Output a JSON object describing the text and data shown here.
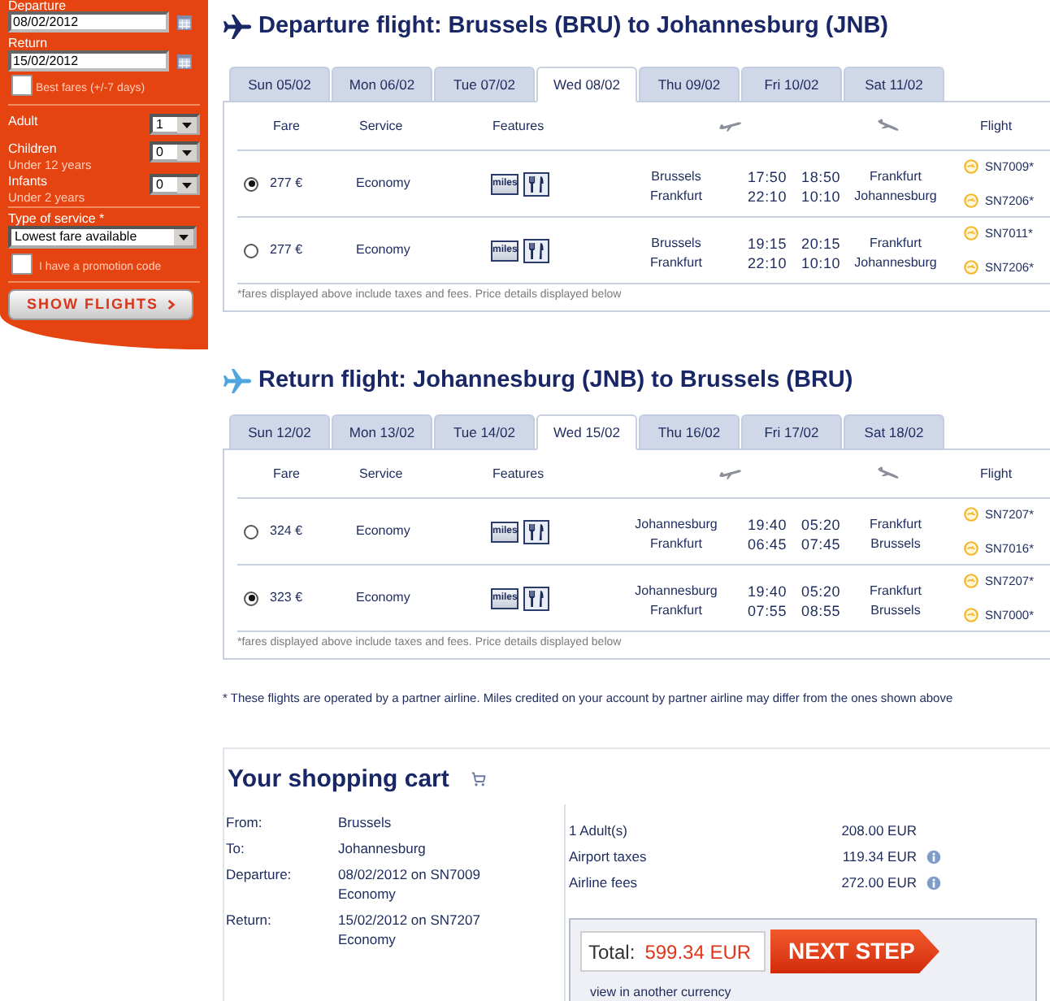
{
  "search_form": {
    "departure": {
      "label": "Departure",
      "value": "08/02/2012"
    },
    "return": {
      "label": "Return",
      "value": "15/02/2012"
    },
    "best_fares": {
      "label": "Best fares (+/-7 days)",
      "checked": false
    },
    "passengers": [
      {
        "label": "Adult",
        "value": "1"
      },
      {
        "label": "Children",
        "note": "Under 12 years",
        "value": "0"
      },
      {
        "label": "Infants",
        "note": "Under 2 years",
        "value": "0"
      }
    ],
    "service_type": {
      "label": "Type of service *",
      "value": "Lowest fare available"
    },
    "promotion_code": {
      "label": "I have a promotion code",
      "checked": false
    },
    "submit_button": "SHOW FLIGHTS"
  },
  "flights": [
    {
      "kind": "departure",
      "title": "Departure flight: Brussels (BRU) to Johannesburg (JNB)",
      "tabs": [
        {
          "label": "Sun 05/02",
          "selected": false
        },
        {
          "label": "Mon 06/02",
          "selected": false
        },
        {
          "label": "Tue 07/02",
          "selected": false
        },
        {
          "label": "Wed 08/02",
          "selected": true
        },
        {
          "label": "Thu 09/02",
          "selected": false
        },
        {
          "label": "Fri 10/02",
          "selected": false
        },
        {
          "label": "Sat 11/02",
          "selected": false
        }
      ],
      "columns": {
        "fare": "Fare",
        "service": "Service",
        "features": "Features",
        "flight": "Flight"
      },
      "rows": [
        {
          "selected": true,
          "fare": "277 €",
          "service": "Economy",
          "features": [
            {
              "kind": "miles",
              "label": "miles"
            },
            {
              "kind": "meal"
            }
          ],
          "segments": [
            {
              "from": "Brussels",
              "depart": "17:50",
              "arrive": "18:50",
              "to": "Frankfurt",
              "flight": "SN7009*"
            },
            {
              "from": "Frankfurt",
              "depart": "22:10",
              "arrive": "10:10",
              "to": "Johannesburg",
              "flight": "SN7206*"
            }
          ]
        },
        {
          "selected": false,
          "fare": "277 €",
          "service": "Economy",
          "features": [
            {
              "kind": "miles",
              "label": "miles"
            },
            {
              "kind": "meal"
            }
          ],
          "segments": [
            {
              "from": "Brussels",
              "depart": "19:15",
              "arrive": "20:15",
              "to": "Frankfurt",
              "flight": "SN7011*"
            },
            {
              "from": "Frankfurt",
              "depart": "22:10",
              "arrive": "10:10",
              "to": "Johannesburg",
              "flight": "SN7206*"
            }
          ]
        }
      ],
      "footnote": "*fares displayed above include taxes and fees. Price details displayed below"
    },
    {
      "kind": "return",
      "title": "Return flight: Johannesburg (JNB) to Brussels (BRU)",
      "tabs": [
        {
          "label": "Sun 12/02",
          "selected": false
        },
        {
          "label": "Mon 13/02",
          "selected": false
        },
        {
          "label": "Tue 14/02",
          "selected": false
        },
        {
          "label": "Wed 15/02",
          "selected": true
        },
        {
          "label": "Thu 16/02",
          "selected": false
        },
        {
          "label": "Fri 17/02",
          "selected": false
        },
        {
          "label": "Sat 18/02",
          "selected": false
        }
      ],
      "columns": {
        "fare": "Fare",
        "service": "Service",
        "features": "Features",
        "flight": "Flight"
      },
      "rows": [
        {
          "selected": false,
          "fare": "324 €",
          "service": "Economy",
          "features": [
            {
              "kind": "miles",
              "label": "miles"
            },
            {
              "kind": "meal"
            }
          ],
          "segments": [
            {
              "from": "Johannesburg",
              "depart": "19:40",
              "arrive": "05:20",
              "to": "Frankfurt",
              "flight": "SN7207*"
            },
            {
              "from": "Frankfurt",
              "depart": "06:45",
              "arrive": "07:45",
              "to": "Brussels",
              "flight": "SN7016*"
            }
          ]
        },
        {
          "selected": true,
          "fare": "323 €",
          "service": "Economy",
          "features": [
            {
              "kind": "miles",
              "label": "miles"
            },
            {
              "kind": "meal"
            }
          ],
          "segments": [
            {
              "from": "Johannesburg",
              "depart": "19:40",
              "arrive": "05:20",
              "to": "Frankfurt",
              "flight": "SN7207*"
            },
            {
              "from": "Frankfurt",
              "depart": "07:55",
              "arrive": "08:55",
              "to": "Brussels",
              "flight": "SN7000*"
            }
          ]
        }
      ],
      "footnote": "*fares displayed above include taxes and fees. Price details displayed below"
    }
  ],
  "partner_note": "* These flights are operated by a partner airline. Miles credited on your account by partner airline may differ from the ones shown above",
  "cart": {
    "title": "Your shopping cart",
    "details": [
      {
        "label": "From:",
        "lines": [
          "Brussels"
        ]
      },
      {
        "label": "To:",
        "lines": [
          "Johannesburg"
        ]
      },
      {
        "label": "Departure:",
        "lines": [
          "08/02/2012 on SN7009",
          "Economy"
        ]
      },
      {
        "label": "Return:",
        "lines": [
          "15/02/2012 on SN7207",
          "Economy"
        ]
      }
    ],
    "prices": [
      {
        "label": "1 Adult(s)",
        "amount": "208.00 EUR",
        "info": false
      },
      {
        "label": "Airport taxes",
        "amount": "119.34 EUR",
        "info": true
      },
      {
        "label": "Airline fees",
        "amount": "272.00 EUR",
        "info": true
      }
    ],
    "total": {
      "label": "Total:",
      "amount": "599.34 EUR"
    },
    "next_button": "NEXT STEP",
    "currency_link": "view in another currency"
  }
}
